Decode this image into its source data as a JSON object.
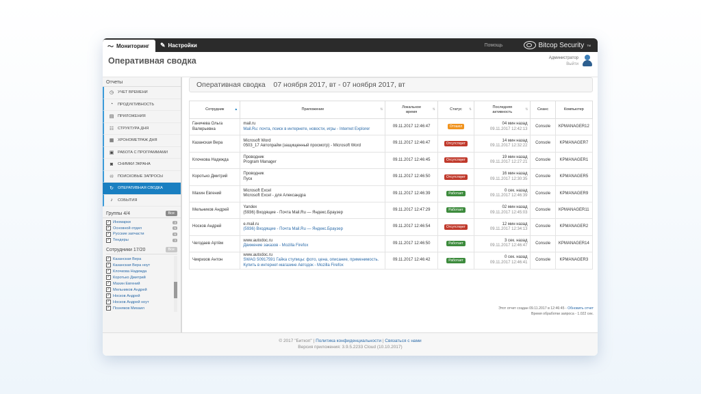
{
  "topbar": {
    "tabs": [
      {
        "label": "Мониторинг"
      },
      {
        "label": "Настройки"
      }
    ],
    "help": "Помощь",
    "brand": "Bitcop Security",
    "brand_tm": "TM"
  },
  "header": {
    "title": "Оперативная сводка",
    "user_role": "Администратор",
    "logout": "Выйти"
  },
  "sidebar": {
    "reports_title": "Отчеты",
    "menu": [
      {
        "label": "Учет времени",
        "icon": "clock-icon"
      },
      {
        "label": "Продуктивность",
        "icon": "pie-chart-icon"
      },
      {
        "label": "Приложения",
        "icon": "apps-icon"
      },
      {
        "label": "Структура дня",
        "icon": "day-structure-icon"
      },
      {
        "label": "Хронометраж дня",
        "icon": "film-icon"
      },
      {
        "label": "Работа с программами",
        "icon": "programs-icon"
      },
      {
        "label": "Снимки экрана",
        "icon": "camera-icon"
      },
      {
        "label": "Поисковые запросы",
        "icon": "binoculars-icon"
      },
      {
        "label": "Оперативная сводка",
        "icon": "refresh-icon"
      },
      {
        "label": "События",
        "icon": "bell-icon"
      }
    ],
    "groups_title": "Группы 4/4",
    "all_label": "Все",
    "groups": [
      {
        "label": "Иномарки",
        "count": "3"
      },
      {
        "label": "Основной отдел",
        "count": "5"
      },
      {
        "label": "Русские запчасти",
        "count": "6"
      },
      {
        "label": "Тендеры",
        "count": "3"
      }
    ],
    "employees_title": "Сотрудники 17/20",
    "employees": [
      "Казанская Вера",
      "Казанская Вера ноут",
      "Клочкова Надежда",
      "Коротько Дмитрий",
      "Махин Евгений",
      "Мельников Андрей",
      "Носков Андрей",
      "Носков Андрей ноут",
      "Позняков Михаил"
    ]
  },
  "report": {
    "heading": "Оперативная сводка",
    "period": "07 ноября 2017, вт - 07 ноября 2017, вт",
    "columns": [
      "Сотрудник",
      "Приложение",
      "Локальное время",
      "Статус",
      "Последняя активность",
      "Сеанс",
      "Компьютер"
    ],
    "rows": [
      {
        "employee": "Ганичева Ольга Валерьевна",
        "app": "mail.ru",
        "window": "Mail.Ru: почта, поиск в интернете, новости, игры - Internet Explorer",
        "window_link": true,
        "time": "09.11.2017 12:46:47",
        "status": "Отошел",
        "status_type": "orange",
        "ago": "04 мин назад",
        "last": "09.11.2017 12:42:13",
        "session": "Console",
        "pc": "KPMANAGER12"
      },
      {
        "employee": "Казанская Вера",
        "app": "Microsoft Word",
        "window": "0503_17 Автопрайм (защищенный просмотр) - Microsoft Word",
        "window_link": false,
        "time": "09.11.2017 12:46:47",
        "status": "Отсутствует",
        "status_type": "red",
        "ago": "14 мин назад",
        "last": "09.11.2017 12:32:22",
        "session": "Console",
        "pc": "KPMANAGER7"
      },
      {
        "employee": "Клочкова Надежда",
        "app": "Проводник",
        "window": "Program Manager",
        "window_link": false,
        "time": "09.11.2017 12:46:45",
        "status": "Отсутствует",
        "status_type": "red",
        "ago": "19 мин назад",
        "last": "09.11.2017 12:27:21",
        "session": "Console",
        "pc": "KPMANAGER1"
      },
      {
        "employee": "Коротько Дмитрий",
        "app": "Проводник",
        "window": "Пуск",
        "window_link": false,
        "time": "09.11.2017 12:46:50",
        "status": "Отсутствует",
        "status_type": "red",
        "ago": "16 мин назад",
        "last": "09.11.2017 12:30:35",
        "session": "Console",
        "pc": "KPMANAGER5"
      },
      {
        "employee": "Махин Евгений",
        "app": "Microsoft Excel",
        "window": "Microsoft Excel - для Александра",
        "window_link": false,
        "time": "09.11.2017 12:46:39",
        "status": "Работает",
        "status_type": "green",
        "ago": "0 сек. назад",
        "last": "09.11.2017 12:46:39",
        "session": "Console",
        "pc": "KPMANAGER9"
      },
      {
        "employee": "Мельников Андрей",
        "app": "Yandex",
        "window": "(5936) Входящие - Почта Mail.Ru — Яндекс.Браузер",
        "window_link": false,
        "time": "09.11.2017 12:47:29",
        "status": "Работает",
        "status_type": "green",
        "ago": "02 мин назад",
        "last": "09.11.2017 12:45:03",
        "session": "Console",
        "pc": "KPMANAGER11"
      },
      {
        "employee": "Носков Андрей",
        "app": "e.mail.ru",
        "window": "(5936) Входящие - Почта Mail.Ru — Яндекс.Браузер",
        "window_link": true,
        "time": "09.11.2017 12:46:54",
        "status": "Отсутствует",
        "status_type": "red",
        "ago": "12 мин назад",
        "last": "09.11.2017 12:34:13",
        "session": "Console",
        "pc": "KPMANAGER2"
      },
      {
        "employee": "Чегодаев Артём",
        "app": "www.autodoc.ru",
        "window": "Движение заказов - Mozilla Firefox",
        "window_link": true,
        "time": "09.11.2017 12:46:50",
        "status": "Работает",
        "status_type": "green",
        "ago": "3 сек. назад",
        "last": "09.11.2017 12:46:47",
        "session": "Console",
        "pc": "KPMANAGER14"
      },
      {
        "employee": "Чикризов Антон",
        "app": "www.autodoc.ru",
        "window": "SWAG 50917591 Гайка ступицы: фото, цена, описание, применимость. Купить в интернет-магазине Автодок - Mozilla Firefox",
        "window_link": true,
        "time": "09.11.2017 12:46:42",
        "status": "Работает",
        "status_type": "green",
        "ago": "0 сек. назад",
        "last": "09.11.2017 12:46:41",
        "session": "Console",
        "pc": "KPMANAGER3"
      }
    ],
    "generated_text": "Этот отчет создан 09.11.2017 в 12:46:45 -",
    "refresh_link": "Обновить отчет",
    "processing_time": "Время обработки запроса - 1.022 сек."
  },
  "footer": {
    "copyright": "© 2017 \"Биткоп\" |",
    "privacy": "Политика конфиденциальности",
    "contact": "Связаться с нами",
    "version": "Версия приложения: 3.9.5.2233 Cloud (10.10.2017)"
  },
  "colors": {
    "accent": "#1a7fc1",
    "topbar": "#2b2b2b",
    "away": "#f0931e",
    "absent": "#c0392b",
    "working": "#3d8b3d"
  }
}
